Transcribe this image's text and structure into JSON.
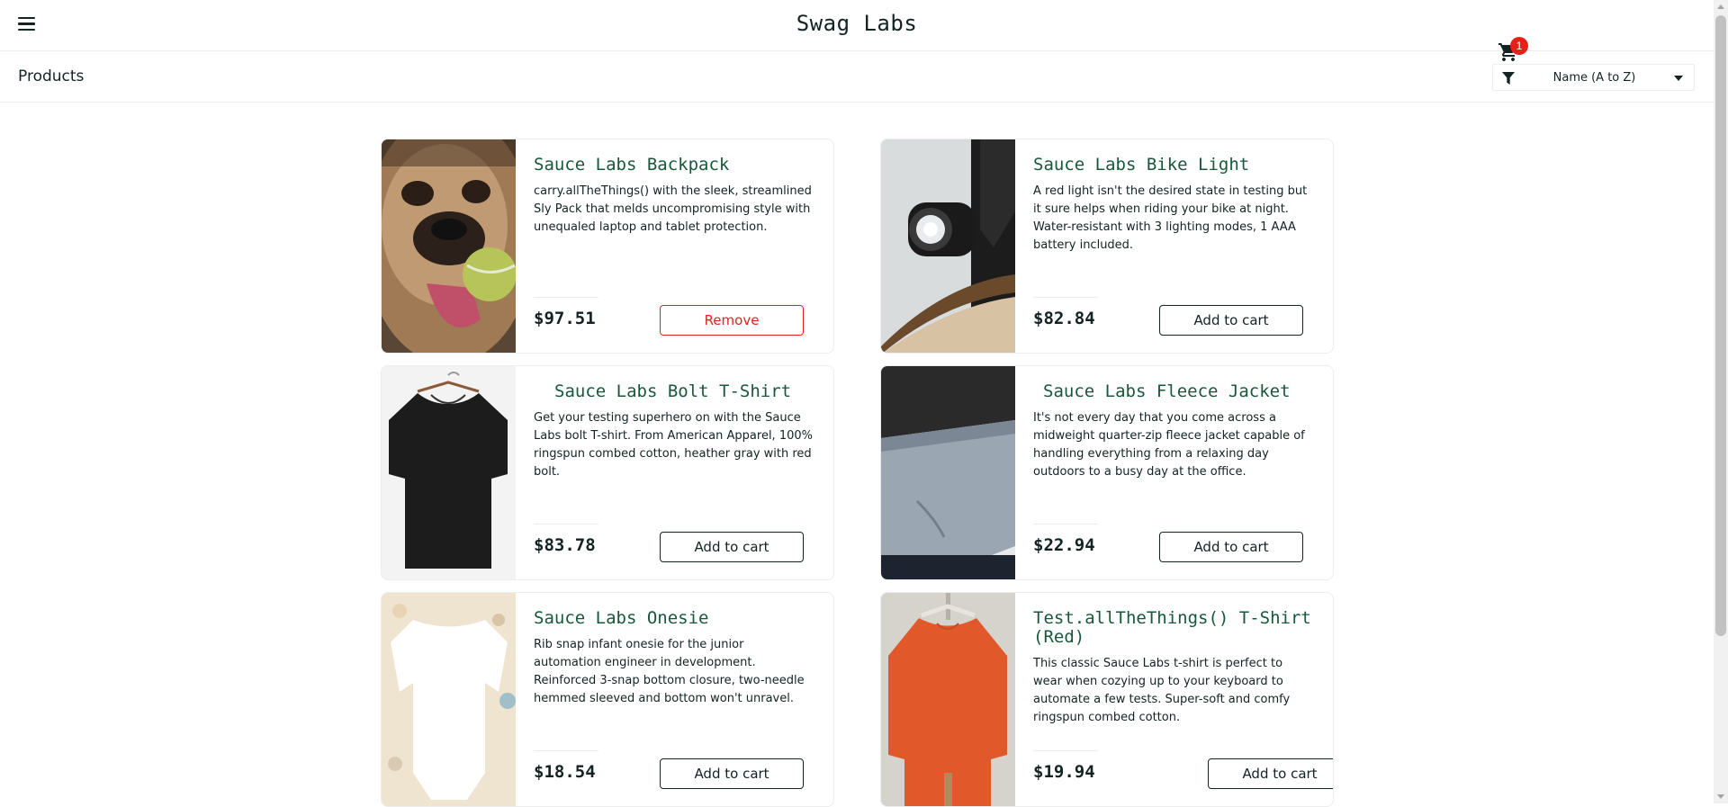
{
  "header": {
    "app_logo": "Swag Labs",
    "cart_count": "1"
  },
  "secondary": {
    "title": "Products",
    "sort": {
      "selected": "Name (A to Z)",
      "options": [
        "Name (A to Z)"
      ]
    }
  },
  "colors": {
    "accent_green": "#18583a",
    "remove_red": "#e2231a",
    "text": "#132322"
  },
  "products": [
    {
      "name": "Sauce Labs Backpack",
      "description": "carry.allTheThings() with the sleek, streamlined Sly Pack that melds uncompromising style with unequaled laptop and tablet protection.",
      "price": "$97.51",
      "button": "Remove",
      "image": "pug-with-ball-photo"
    },
    {
      "name": "Sauce Labs Bike Light",
      "description": "A red light isn't the desired state in testing but it sure helps when riding your bike at night. Water-resistant with 3 lighting modes, 1 AAA battery included.",
      "price": "$82.84",
      "button": "Add to cart",
      "image": "bike-light-photo"
    },
    {
      "name": "Sauce Labs Bolt T-Shirt",
      "description": "Get your testing superhero on with the Sauce Labs bolt T-shirt. From American Apparel, 100% ringspun combed cotton, heather gray with red bolt.",
      "price": "$83.78",
      "button": "Add to cart",
      "image": "black-tshirt-photo"
    },
    {
      "name": "Sauce Labs Fleece Jacket",
      "description": "It's not every day that you come across a midweight quarter-zip fleece jacket capable of handling everything from a relaxing day outdoors to a busy day at the office.",
      "price": "$22.94",
      "button": "Add to cart",
      "image": "fleece-jacket-photo"
    },
    {
      "name": "Sauce Labs Onesie",
      "description": "Rib snap infant onesie for the junior automation engineer in development. Reinforced 3-snap bottom closure, two-needle hemmed sleeved and bottom won't unravel.",
      "price": "$18.54",
      "button": "Add to cart",
      "image": "white-onesie-photo"
    },
    {
      "name": "Test.allTheThings() T-Shirt (Red)",
      "description": "This classic Sauce Labs t-shirt is perfect to wear when cozying up to your keyboard to automate a few tests. Super-soft and comfy ringspun combed cotton.",
      "price": "$19.94",
      "button": "Add to cart",
      "image": "red-sweatshirt-photo"
    }
  ]
}
